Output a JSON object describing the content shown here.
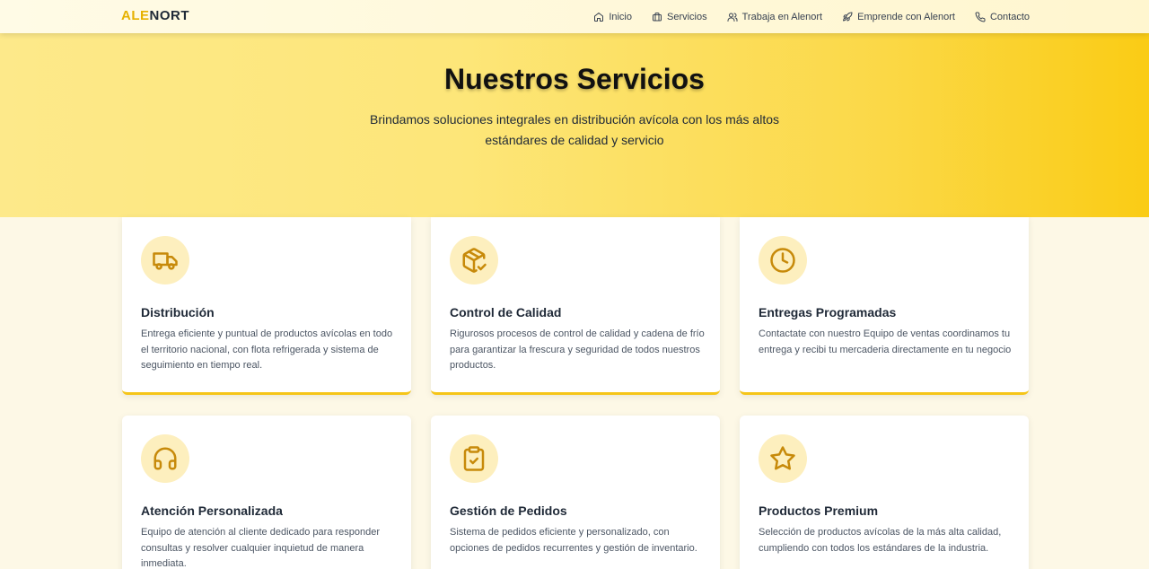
{
  "brand": {
    "part1": "ALE",
    "part2": "NORT",
    "accent": "#e6b100"
  },
  "nav": [
    {
      "label": "Inicio",
      "icon": "home-icon"
    },
    {
      "label": "Servicios",
      "icon": "briefcase-icon"
    },
    {
      "label": "Trabaja en Alenort",
      "icon": "users-icon"
    },
    {
      "label": "Emprende con Alenort",
      "icon": "rocket-icon"
    },
    {
      "label": "Contacto",
      "icon": "phone-icon"
    }
  ],
  "hero": {
    "title": "Nuestros Servicios",
    "subtitle": "Brindamos soluciones integrales en distribución avícola con los más altos estándares de calidad y servicio"
  },
  "services": [
    {
      "icon": "truck-icon",
      "title": "Distribución",
      "description": "Entrega eficiente y puntual de productos avícolas en todo el territorio nacional, con flota refrigerada y sistema de seguimiento en tiempo real."
    },
    {
      "icon": "package-check-icon",
      "title": "Control de Calidad",
      "description": "Rigurosos procesos de control de calidad y cadena de frío para garantizar la frescura y seguridad de todos nuestros productos."
    },
    {
      "icon": "clock-icon",
      "title": "Entregas Programadas",
      "description": "Contactate con nuestro Equipo de ventas coordinamos tu entrega y recibi tu mercaderia directamente en tu negocio"
    },
    {
      "icon": "headset-icon",
      "title": "Atención Personalizada",
      "description": "Equipo de atención al cliente dedicado para responder consultas y resolver cualquier inquietud de manera inmediata."
    },
    {
      "icon": "clipboard-check-icon",
      "title": "Gestión de Pedidos",
      "description": "Sistema de pedidos eficiente y personalizado, con opciones de pedidos recurrentes y gestión de inventario."
    },
    {
      "icon": "star-icon",
      "title": "Productos Premium",
      "description": "Selección de productos avícolas de la más alta calidad, cumpliendo con todos los estándares de la industria."
    }
  ]
}
